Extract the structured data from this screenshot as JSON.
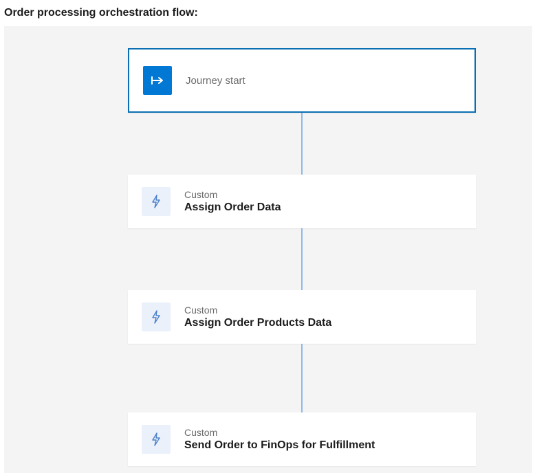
{
  "page": {
    "title": "Order processing orchestration flow:"
  },
  "flow": {
    "start": {
      "label": "Journey start"
    },
    "steps": [
      {
        "kind": "Custom",
        "title": "Assign Order Data"
      },
      {
        "kind": "Custom",
        "title": "Assign Order Products Data"
      },
      {
        "kind": "Custom",
        "title": "Send Order to FinOps for Fulfillment"
      }
    ]
  }
}
